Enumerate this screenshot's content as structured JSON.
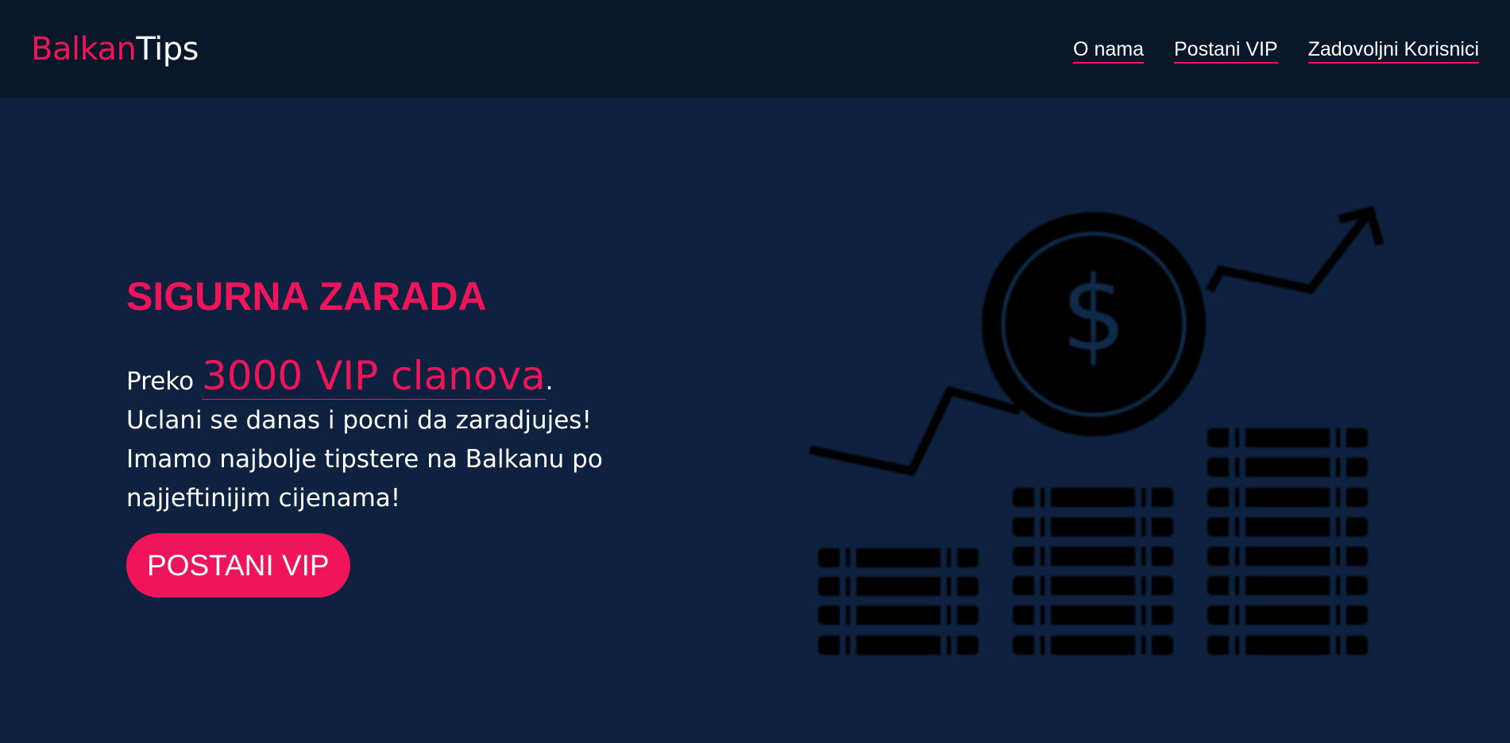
{
  "header": {
    "logo_part1": "Balkan",
    "logo_part2": "Tips",
    "nav": [
      {
        "label": "O nama"
      },
      {
        "label": "Postani VIP"
      },
      {
        "label": "Zadovoljni Korisnici"
      }
    ]
  },
  "hero": {
    "title": "SIGURNA ZARADA",
    "preko": "Preko",
    "count": "3000 VIP clanova",
    "period": ".",
    "line2": "Uclani se danas i pocni da zaradjujes!",
    "line3": "Imamo najbolje tipstere na Balkanu po najjeftinijim cijenama!",
    "cta": "POSTANI VIP"
  },
  "illustration": {
    "icon": "money-growth-icon"
  },
  "colors": {
    "accent": "#f0155a",
    "background": "#0e2240",
    "header_background": "#081729",
    "text": "#ffffff"
  }
}
